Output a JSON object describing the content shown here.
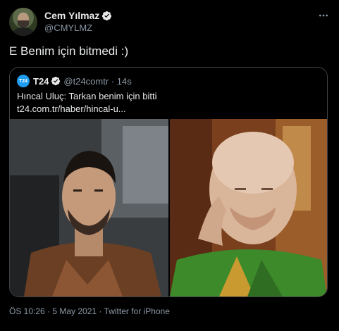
{
  "tweet": {
    "author": {
      "name": "Cem Yılmaz",
      "handle": "@CMYLMZ",
      "verified": true
    },
    "text": "E Benim için bitmedi :)",
    "timestamp": "ÖS 10:26 · 5 May 2021 · Twitter for iPhone",
    "icons": {
      "more": "more-horizontal-icon",
      "verified": "verified-badge-icon"
    }
  },
  "quote": {
    "logo_text": "T24",
    "name": "T24",
    "handle": "@t24comtr · 14s",
    "text_line1": "Hıncal Uluç: Tarkan benim için bitti",
    "text_line2": "t24.com.tr/haber/hincal-u...",
    "media": [
      "photo-man-in-car",
      "photo-elderly-man-green-scarf"
    ]
  },
  "colors": {
    "background": "#000000",
    "text": "#e7e9ea",
    "secondary_text": "#8b98a5",
    "verified_blue": "#1d9bf0",
    "border": "#3e4144"
  }
}
